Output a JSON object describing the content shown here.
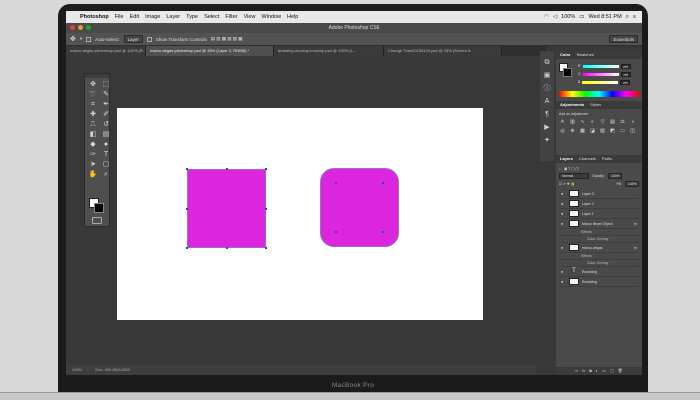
{
  "menubar": {
    "app": "Photoshop",
    "items": [
      "File",
      "Edit",
      "Image",
      "Layer",
      "Type",
      "Select",
      "Filter",
      "View",
      "Window",
      "Help"
    ],
    "battery": "100%",
    "clock": "Wed 8:51 PM"
  },
  "window": {
    "title": "Adobe Photoshop CS6"
  },
  "options": {
    "auto_select_label": "Auto-Select:",
    "auto_select_value": "Layer",
    "transform_label": "Show Transform Controls",
    "workspace": "Essentials"
  },
  "tabs": [
    {
      "label": "marco-degas-photoshop.psd @ 100% (R..."
    },
    {
      "label": "marco-degas-photoshop.psd @ 33% (Layer 2, RGB/8) *"
    },
    {
      "label": "branding-mockup-mockup.psd @ 100% (L..."
    },
    {
      "label": "Change Then20150120.psd @ 25% (Screen 5..."
    }
  ],
  "status": {
    "zoom": "100%",
    "doc": "Doc: 999.8K/8.20M"
  },
  "panels": {
    "color_tabs": [
      "Color",
      "Swatches"
    ],
    "color_values": [
      "255",
      "255",
      "255"
    ],
    "adjust_tabs": [
      "Adjustments",
      "Styles"
    ],
    "adjust_label": "Add an adjustment",
    "layers_tabs": [
      "Layers",
      "Channels",
      "Paths"
    ],
    "blend_mode": "Normal",
    "opacity_label": "Opacity:",
    "opacity_value": "100%",
    "fill_label": "Fill:",
    "fill_value": "100%",
    "layers": [
      {
        "name": "Layer 3",
        "kind": "image"
      },
      {
        "name": "Layer 2",
        "kind": "image"
      },
      {
        "name": "Layer 1",
        "kind": "image"
      },
      {
        "name": "Marco Bezel Object",
        "kind": "image",
        "effects": [
          "Effects",
          "Color Overlay"
        ]
      },
      {
        "name": "marco-degas",
        "kind": "image",
        "effects": [
          "Effects",
          "Color Overlay"
        ]
      },
      {
        "name": "Rounding",
        "kind": "text"
      },
      {
        "name": "Rounding",
        "kind": "image"
      }
    ]
  },
  "device": {
    "label": "MacBook Pro"
  },
  "colors": {
    "shape_fill": "#db26dd",
    "canvas_bg": "#ffffff",
    "ui_dark": "#383838"
  }
}
